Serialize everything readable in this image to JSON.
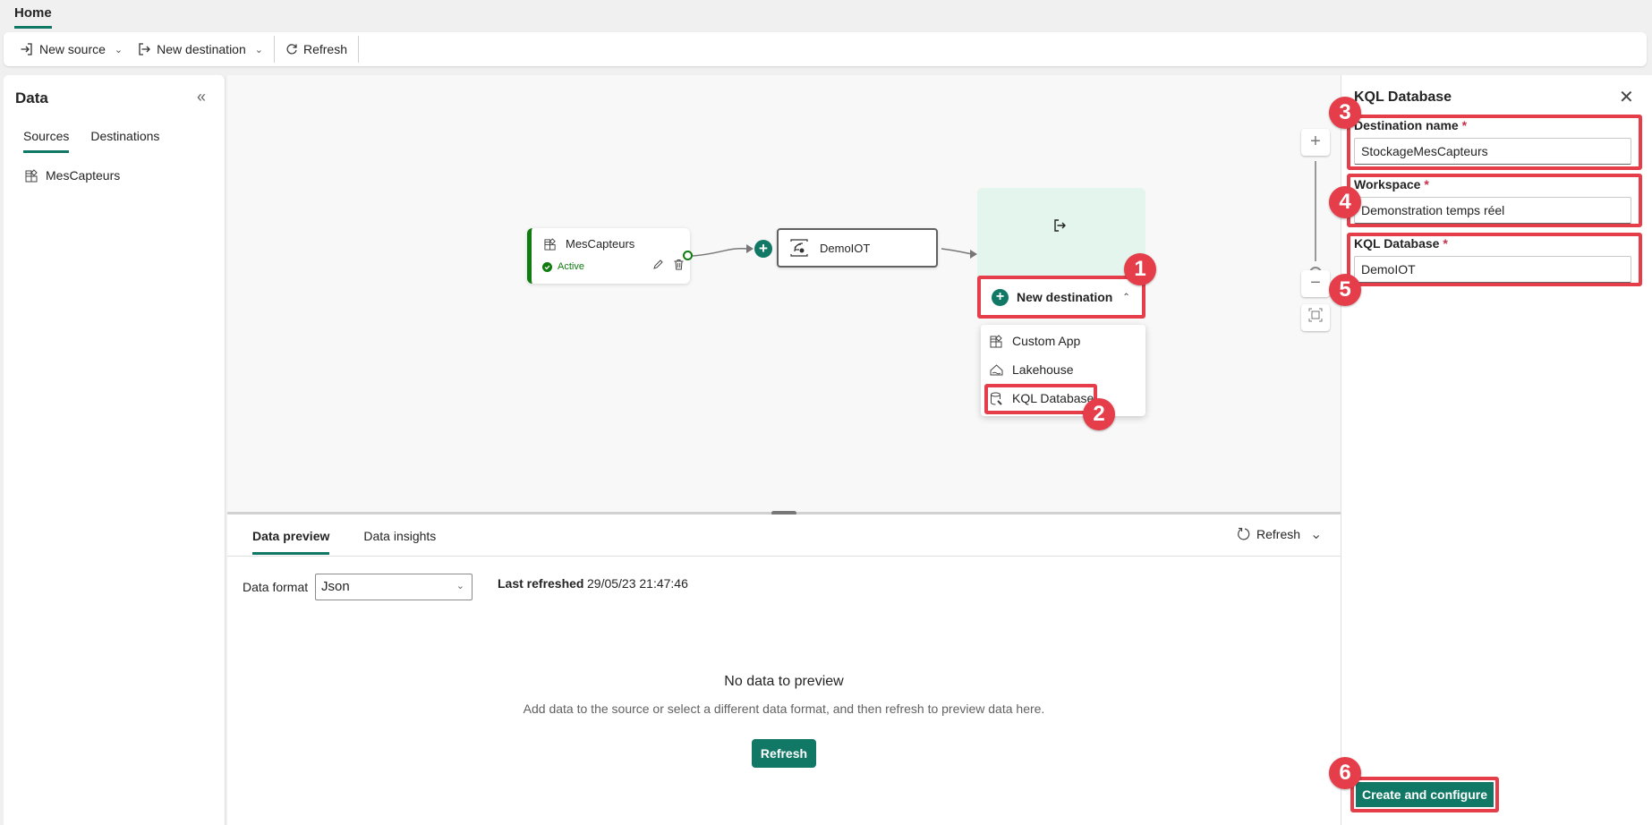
{
  "topbar": {
    "home_tab": "Home"
  },
  "toolbar": {
    "new_source": "New source",
    "new_destination": "New destination",
    "refresh": "Refresh"
  },
  "left_panel": {
    "title": "Data",
    "tabs": [
      {
        "label": "Sources",
        "active": true
      },
      {
        "label": "Destinations",
        "active": false
      }
    ],
    "items": [
      {
        "label": "MesCapteurs",
        "icon": "custom-app-icon"
      }
    ]
  },
  "canvas": {
    "source_node": {
      "name": "MesCapteurs",
      "status": "Active"
    },
    "stream_node": {
      "name": "DemoIOT"
    },
    "new_destination_button": "New destination",
    "destination_menu": [
      {
        "label": "Custom App",
        "icon": "custom-app-icon"
      },
      {
        "label": "Lakehouse",
        "icon": "lakehouse-icon"
      },
      {
        "label": "KQL Database",
        "icon": "kql-database-icon"
      }
    ],
    "step_badges": [
      "1",
      "2",
      "3",
      "4",
      "5",
      "6"
    ]
  },
  "bottom_panel": {
    "tabs": [
      {
        "label": "Data preview",
        "active": true
      },
      {
        "label": "Data insights",
        "active": false
      }
    ],
    "refresh": "Refresh",
    "data_format_label": "Data format",
    "data_format_value": "Json",
    "last_refreshed_label": "Last refreshed",
    "last_refreshed_value": "29/05/23 21:47:46",
    "empty_title": "No data to preview",
    "empty_description": "Add data to the source or select a different data format, and then refresh to preview data here.",
    "empty_refresh_button": "Refresh"
  },
  "right_panel": {
    "title": "KQL Database",
    "fields": [
      {
        "label": "Destination name",
        "required": "*",
        "value": "StockageMesCapteurs"
      },
      {
        "label": "Workspace",
        "required": "*",
        "value": "Demonstration temps réel"
      },
      {
        "label": "KQL Database",
        "required": "*",
        "value": "DemoIOT"
      }
    ],
    "create_button": "Create and configure"
  },
  "colors": {
    "accent": "#117865",
    "highlight": "#e53e4a",
    "active_green": "#107c10",
    "destination_bg": "#e3f5ec"
  }
}
